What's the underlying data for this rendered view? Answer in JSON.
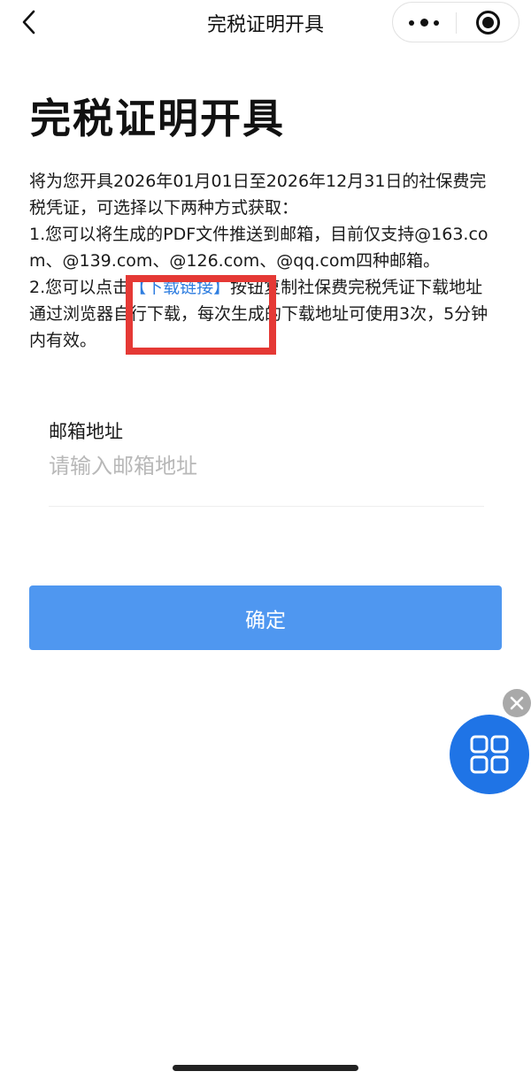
{
  "nav": {
    "title": "完税证明开具",
    "back_icon": "chevron-left-icon",
    "more_icon": "more-dots-icon",
    "close_icon": "target-close-icon"
  },
  "page": {
    "title": "完税证明开具"
  },
  "description": {
    "intro": "将为您开具2026年01月01日至2026年12月31日的社保费完税凭证，可选择以下两种方式获取：",
    "option1": "1.您可以将生成的PDF文件推送到邮箱，目前仅支持@163.com、@139.com、@126.com、@qq.com四种邮箱。",
    "option2_prefix": "2.您可以点击",
    "option2_link": "【下载链接】",
    "option2_suffix": "按钮复制社保费完税凭证下载地址通过浏览器自行下载，每次生成的下载地址可使用3次，5分钟内有效。"
  },
  "email": {
    "label": "邮箱地址",
    "placeholder": "请输入邮箱地址",
    "value": ""
  },
  "confirm": {
    "label": "确定"
  },
  "floating": {
    "close_icon": "close-icon",
    "menu_icon": "grid-icon"
  },
  "colors": {
    "accent": "#4f97f0",
    "link": "#2f7ee0",
    "highlight": "#e53935",
    "float_button": "#1f74e6"
  }
}
